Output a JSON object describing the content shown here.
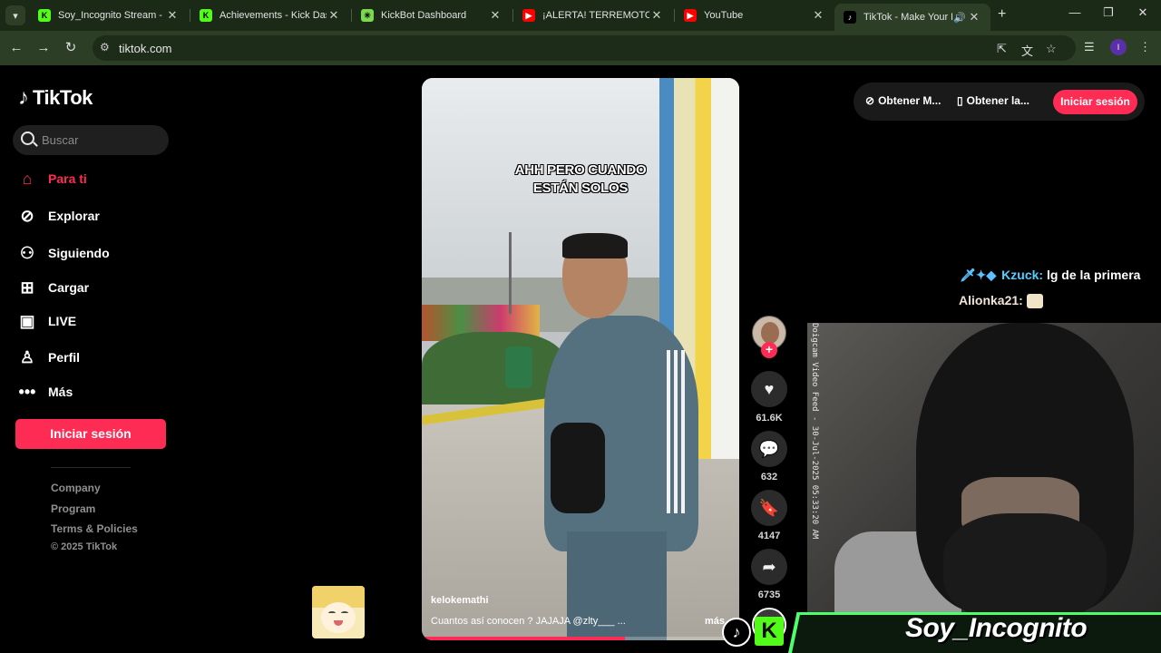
{
  "browser": {
    "tabs": [
      {
        "title": "Soy_Incognito Stream - W",
        "favicon": "kick-icon",
        "color": "#53fc18"
      },
      {
        "title": "Achievements - Kick Dashb",
        "favicon": "kick-icon",
        "color": "#53fc18"
      },
      {
        "title": "KickBot Dashboard",
        "favicon": "kickbot-icon",
        "color": "#7cd84f"
      },
      {
        "title": "¡ALERTA! TERREMOTO d",
        "favicon": "youtube-icon",
        "color": "#ff0000"
      },
      {
        "title": "YouTube",
        "favicon": "youtube-icon",
        "color": "#ff0000"
      },
      {
        "title": "TikTok - Make Your Da",
        "favicon": "tiktok-icon",
        "color": "#000000"
      }
    ],
    "url": "tiktok.com",
    "profile_initial": "I"
  },
  "sidebar": {
    "logo": "TikTok",
    "search_placeholder": "Buscar",
    "nav": [
      {
        "label": "Para ti",
        "icon": "home-icon"
      },
      {
        "label": "Explorar",
        "icon": "compass-icon"
      },
      {
        "label": "Siguiendo",
        "icon": "following-icon"
      },
      {
        "label": "Cargar",
        "icon": "upload-icon"
      },
      {
        "label": "LIVE",
        "icon": "live-icon"
      },
      {
        "label": "Perfil",
        "icon": "profile-icon"
      },
      {
        "label": "Más",
        "icon": "more-icon"
      }
    ],
    "login_label": "Iniciar sesión",
    "footer_links": [
      "Company",
      "Program",
      "Terms & Policies"
    ],
    "copyright": "© 2025 TikTok"
  },
  "header": {
    "link1": "Obtener M...",
    "link2": "Obtener la...",
    "login_label": "Iniciar sesión"
  },
  "video": {
    "overlay_line1": "AHH PERO CUANDO",
    "overlay_line2": "ESTÁN SOLOS",
    "author": "kelokemathi",
    "description": "Cuantos así conocen ? JAJAJA @zlty___  ...",
    "more_label": "más",
    "progress": 0.64
  },
  "actions": {
    "likes": "61.6K",
    "comments": "632",
    "saves": "4147",
    "shares": "6735"
  },
  "stream": {
    "chat": [
      {
        "user": "Kzuck:",
        "message": "lg de la primera"
      },
      {
        "user": "Alionka21:",
        "message": ""
      }
    ],
    "webcam_label": "Doigcam Video Feed - 30-Jul-2025 05:33:20 AM",
    "streamer_name": "Soy_Incognito"
  },
  "colors": {
    "accent": "#fe2c55",
    "kick_green": "#53fc18"
  }
}
